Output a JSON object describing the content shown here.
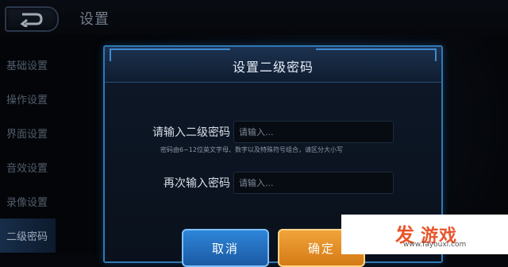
{
  "header": {
    "title": "设置"
  },
  "sidebar": {
    "items": [
      {
        "label": "基础设置"
      },
      {
        "label": "操作设置"
      },
      {
        "label": "界面设置"
      },
      {
        "label": "音效设置"
      },
      {
        "label": "录像设置"
      },
      {
        "label": "二级密码",
        "active": true
      }
    ]
  },
  "dialog": {
    "title": "设置二级密码",
    "password_label": "请输入二级密码",
    "password_placeholder": "请输入...",
    "hint": "密码由6~12位英文字母、数字以及特殊符号组合，请区分大小写",
    "confirm_label": "再次输入密码",
    "confirm_placeholder": "请输入...",
    "cancel_label": "取消",
    "ok_label": "确定"
  },
  "watermark": {
    "brand": "游戏",
    "logo_char": "发",
    "url": "www.fayouxi.com"
  },
  "colors": {
    "accent_blue": "#2f79b5",
    "cancel_button": "#2e86d8",
    "ok_button": "#f1a43a",
    "watermark_brand": "#e8552a"
  }
}
